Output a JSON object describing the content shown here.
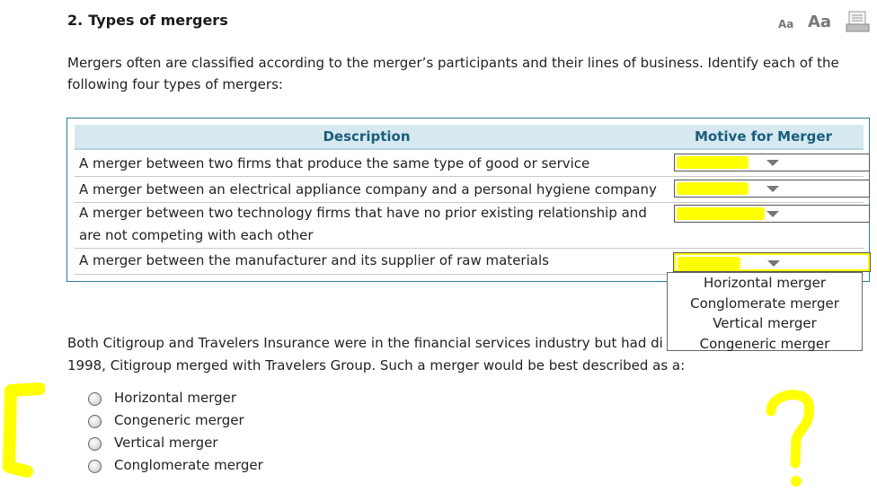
{
  "question": {
    "number": "2.",
    "title": "Types of mergers",
    "intro": "Mergers often are classified according to the merger’s participants and their lines of business. Identify each of the following four types of mergers:"
  },
  "toolbar": {
    "font_small": "Aa",
    "font_large": "Aa"
  },
  "table": {
    "header_description": "Description",
    "header_motive": "Motive for Merger",
    "rows": [
      {
        "description": "A merger between two firms that produce the same type of good or service"
      },
      {
        "description": "A merger between an electrical appliance company and a personal hygiene company"
      },
      {
        "description": "A merger between two technology firms that have no prior existing relationship and are not competing with each other"
      },
      {
        "description": "A merger between the manufacturer and its supplier of raw materials"
      }
    ]
  },
  "dropdown_options": [
    "Horizontal merger",
    "Conglomerate merger",
    "Vertical merger",
    "Congeneric merger"
  ],
  "question2": {
    "line1": "Both Citigroup and Travelers Insurance were in the financial services industry but had di",
    "line2": "1998, Citigroup merged with Travelers Group. Such a merger would be best described as a:",
    "options": [
      "Horizontal merger",
      "Congeneric merger",
      "Vertical merger",
      "Conglomerate merger"
    ]
  },
  "colors": {
    "highlight": "#ffff00",
    "header_text": "#1b5d7a",
    "table_border": "#2f7a9a",
    "header_bg": "#d6e8f0"
  }
}
